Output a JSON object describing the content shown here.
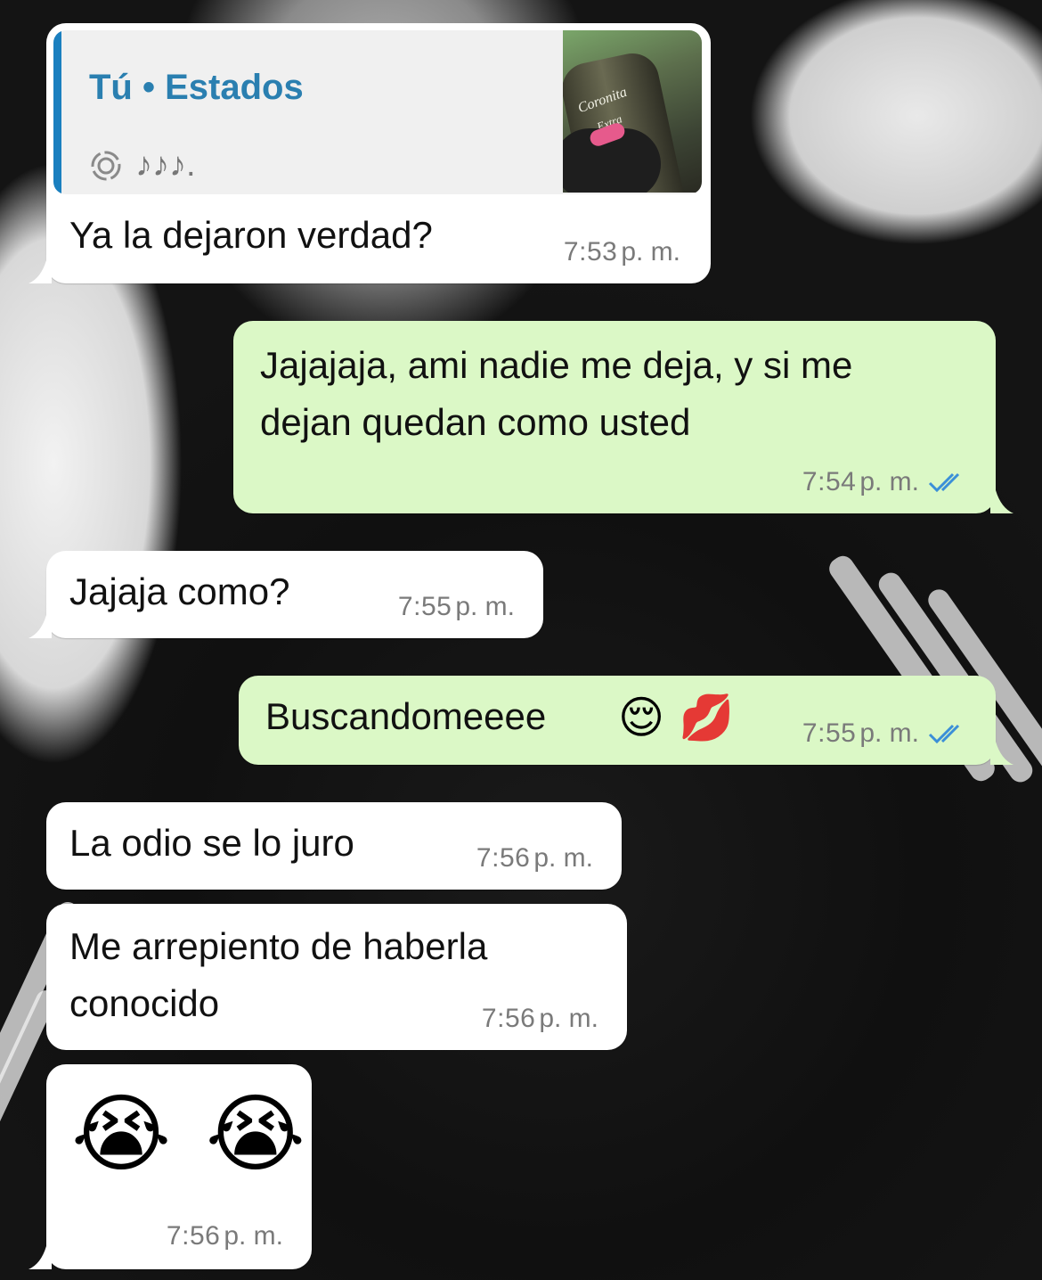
{
  "quote": {
    "title": "Tú • Estados",
    "subtitle_notes": "♪♪♪.",
    "status_icon": "status-ring-icon",
    "thumbnail_bottle_label": "Coronita",
    "thumbnail_bottle_sub": "Extra"
  },
  "messages": [
    {
      "direction": "in",
      "text": "Ya la dejaron verdad?",
      "time": "7:53",
      "ampm": "p. m."
    },
    {
      "direction": "out",
      "text": "Jajajaja, ami nadie me deja, y si me\ndejan quedan como usted",
      "time": "7:54",
      "ampm": "p. m.",
      "read": true
    },
    {
      "direction": "in",
      "text": "Jajaja como?",
      "time": "7:55",
      "ampm": "p. m."
    },
    {
      "direction": "out",
      "text": "Buscandomeeee",
      "emoji": "😌 💋",
      "time": "7:55",
      "ampm": "p. m.",
      "read": true
    },
    {
      "direction": "in",
      "text": "La odio se lo juro",
      "time": "7:56",
      "ampm": "p. m."
    },
    {
      "direction": "in",
      "text": "Me arrepiento de haberla\nconocido",
      "time": "7:56",
      "ampm": "p. m."
    },
    {
      "direction": "in",
      "text": "",
      "emoji": "😭 😭",
      "time": "7:56",
      "ampm": "p. m."
    }
  ],
  "colors": {
    "incoming_bubble": "#ffffff",
    "outgoing_bubble": "#dbf8c6",
    "quote_accent": "#1a7fbf",
    "read_ticks": "#3b8fd8"
  }
}
